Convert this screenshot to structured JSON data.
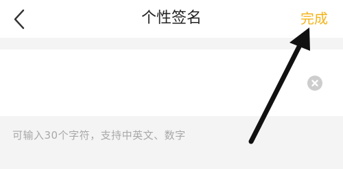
{
  "header": {
    "back_icon": "chevron-left-icon",
    "title": "个性签名",
    "done_label": "完成"
  },
  "signature": {
    "value": "",
    "clear_icon": "clear-circle-icon"
  },
  "hint": {
    "text": "可输入30个字符，支持中英文、数字"
  },
  "colors": {
    "accent": "#f3b31a",
    "background": "#f4f4f4",
    "panel": "#ffffff",
    "hint_text": "#a8a8a8",
    "title_text": "#222222",
    "annotation_arrow": "#111111"
  }
}
